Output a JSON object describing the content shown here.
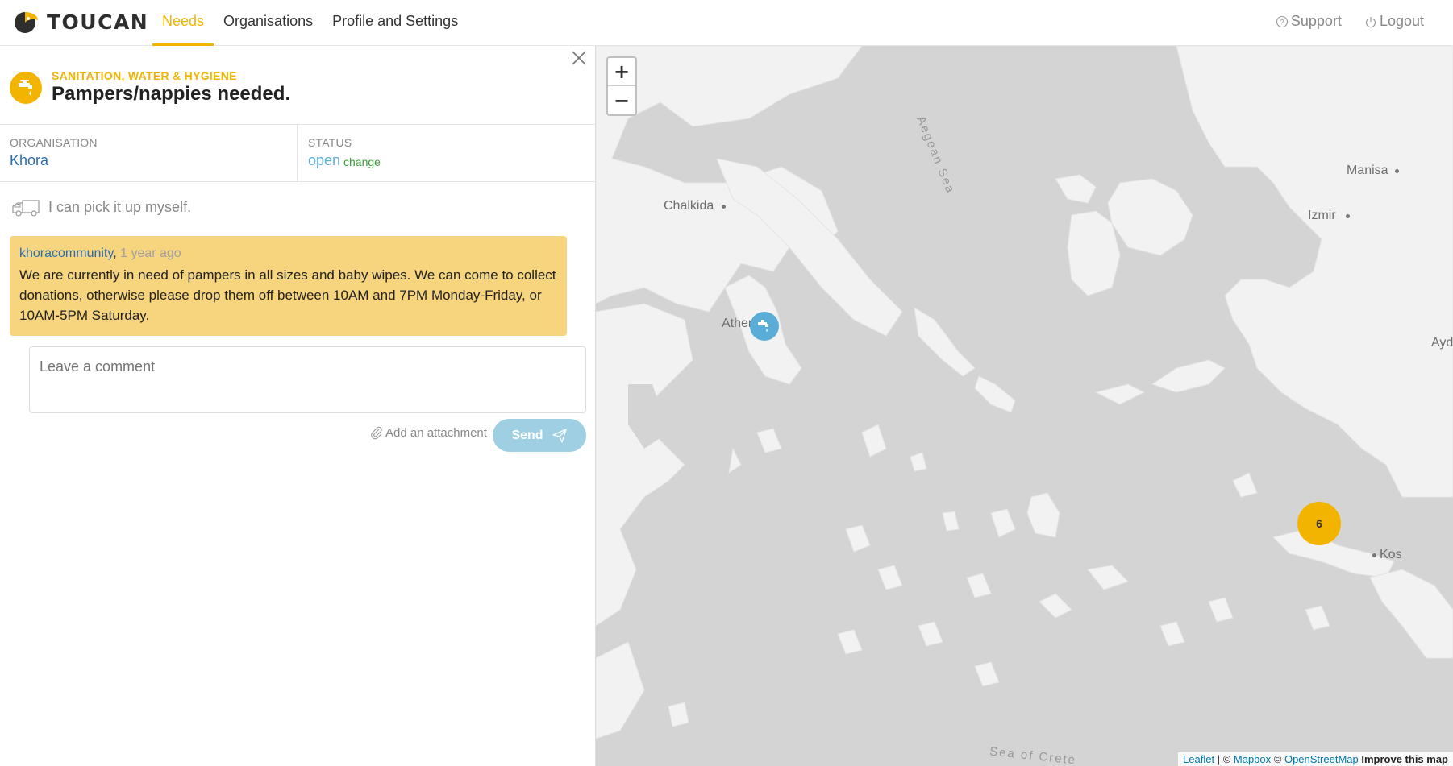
{
  "app": {
    "brand": "TOUCAN"
  },
  "nav": {
    "needs": "Needs",
    "organisations": "Organisations",
    "profile": "Profile and Settings",
    "support": "Support",
    "logout": "Logout"
  },
  "need": {
    "category": "SANITATION, WATER & HYGIENE",
    "title": "Pampers/nappies needed.",
    "category_icon": "tap-icon",
    "organisation_label": "ORGANISATION",
    "organisation": "Khora",
    "status_label": "STATUS",
    "status": "open",
    "status_change": "change",
    "pickup": "I can pick it up myself."
  },
  "comment": {
    "author": "khoracommunity",
    "separator": ",",
    "time": "1 year ago",
    "text": "We are currently in need of pampers in all sizes and baby wipes. We can come to collect donations, otherwise please drop them off between 10AM and 7PM Monday-Friday, or 10AM-5PM Saturday."
  },
  "compose": {
    "placeholder": "Leave a comment",
    "attach": "Add an attachment",
    "send": "Send"
  },
  "map": {
    "zoom_in": "+",
    "zoom_out": "−",
    "places": {
      "chalkida": "Chalkida",
      "athens": "Athens",
      "manisa": "Manisa",
      "izmir": "Izmir",
      "kos": "Kos",
      "aydin": "Ayd"
    },
    "seas": {
      "aegean": "Aegean Sea",
      "crete": "Sea of Crete"
    },
    "cluster_count": "6",
    "attribution": {
      "leaflet": "Leaflet",
      "sep1": " | © ",
      "mapbox": "Mapbox",
      "sep2": " © ",
      "osm": "OpenStreetMap",
      "improve": "Improve this map"
    },
    "colors": {
      "water": "#d4d4d4",
      "land": "#f2f2f2",
      "cluster": "#f3b400",
      "marker": "#5aadd6"
    }
  }
}
